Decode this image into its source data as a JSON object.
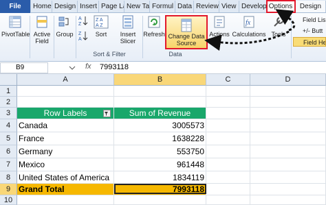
{
  "tabs": [
    {
      "label": "File"
    },
    {
      "label": "Home"
    },
    {
      "label": "Design"
    },
    {
      "label": "Insert"
    },
    {
      "label": "Page La"
    },
    {
      "label": "New Ta"
    },
    {
      "label": "Formul"
    },
    {
      "label": "Data"
    },
    {
      "label": "Review"
    },
    {
      "label": "View"
    },
    {
      "label": "Develop"
    },
    {
      "label": "Options"
    },
    {
      "label": "Design"
    }
  ],
  "ribbon": {
    "pivottable_label": "PivotTable",
    "active_field_label": "Active\nField",
    "group_label": "Group",
    "sort_label": "Sort",
    "insert_slicer_label": "Insert\nSlicer",
    "refresh_label": "Refresh",
    "change_data_source_label": "Change Data\nSource",
    "actions_label": "Actions",
    "calculations_label": "Calculations",
    "tools_label": "Tools",
    "sort_filter_group": "Sort & Filter",
    "data_group": "Data",
    "side": [
      "Field Lis",
      "+/- Butt",
      "Field He"
    ]
  },
  "formula_bar": {
    "name_box": "B9",
    "fx": "fx",
    "value": "7993118"
  },
  "grid": {
    "columns": [
      "A",
      "B",
      "C",
      "D"
    ],
    "rows": [
      "1",
      "2",
      "3",
      "4",
      "5",
      "6",
      "7",
      "8",
      "9",
      "10"
    ],
    "header": {
      "row_labels": "Row Labels",
      "sum_of_revenue": "Sum of Revenue"
    },
    "data": [
      {
        "label": "Canada",
        "value": "3005573"
      },
      {
        "label": "France",
        "value": "1638228"
      },
      {
        "label": "Germany",
        "value": "553750"
      },
      {
        "label": "Mexico",
        "value": "961448"
      },
      {
        "label": "United States of America",
        "value": "1834119"
      }
    ],
    "grand_total": {
      "label": "Grand Total",
      "value": "7993118"
    }
  },
  "colors": {
    "pivot_header": "#19a76b",
    "grand_total": "#f6b800",
    "highlight": "#e2172b"
  }
}
